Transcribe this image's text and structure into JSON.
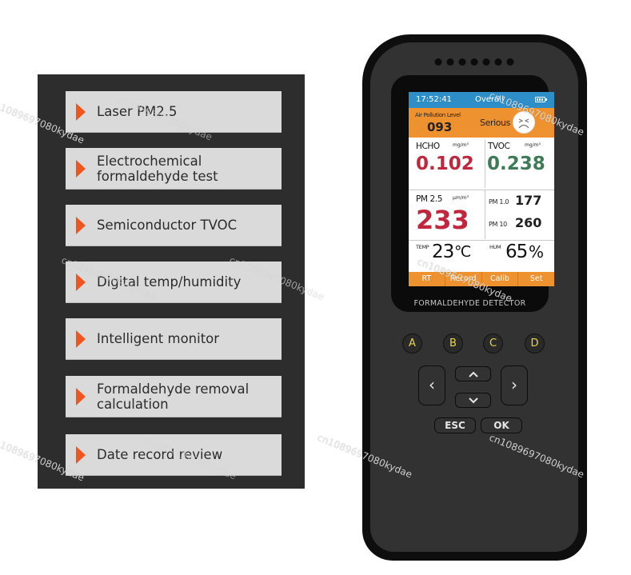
{
  "features": [
    {
      "label": "Laser PM2.5",
      "icon": "triangle-right-icon"
    },
    {
      "label": "Electrochemical formaldehyde test",
      "icon": "triangle-right-icon"
    },
    {
      "label": "Semiconductor TVOC",
      "icon": "triangle-right-icon"
    },
    {
      "label": "Digital temp/humidity",
      "icon": "triangle-right-icon"
    },
    {
      "label": "Intelligent monitor",
      "icon": "triangle-right-icon"
    },
    {
      "label": "Formaldehyde removal calculation",
      "icon": "triangle-right-icon"
    },
    {
      "label": "Date record review",
      "icon": "triangle-right-icon"
    }
  ],
  "device": {
    "brand": "FORMALDEHYDE DETECTOR",
    "screen": {
      "time": "17:52:41",
      "mode": "Overall",
      "battery_icon": "battery-full-icon",
      "air_pollution_label": "Air Pollution Level",
      "air_pollution_value": "093",
      "air_status": "Serious",
      "status_face_icon": "sad-face-icon",
      "hcho": {
        "label": "HCHO",
        "unit": "mg/m³",
        "value": "0.102"
      },
      "tvoc": {
        "label": "TVOC",
        "unit": "mg/m³",
        "value": "0.238"
      },
      "pm25": {
        "label": "PM 2.5",
        "unit": "μm/m³",
        "value": "233"
      },
      "pm10_1": {
        "label": "PM 1.0",
        "value": "177"
      },
      "pm10": {
        "label": "PM 10",
        "value": "260"
      },
      "temp": {
        "label": "TEMP",
        "value": "23",
        "unit": "℃"
      },
      "hum": {
        "label": "HUM",
        "value": "65",
        "unit": "%"
      },
      "softkeys": [
        "RT",
        "Record",
        "Calib",
        "Set"
      ]
    },
    "keys": {
      "function": [
        "A",
        "B",
        "C",
        "D"
      ],
      "left": "‹",
      "right": "›",
      "up": "⌃",
      "down": "⌄",
      "esc": "ESC",
      "ok": "OK"
    },
    "colors": {
      "header_blue": "#2e8fc8",
      "accent_orange": "#ed922e",
      "value_red": "#c0263c",
      "value_green": "#3d7a55",
      "key_yellow": "#e9d44a"
    }
  },
  "watermark": "cn1089697080kydae"
}
